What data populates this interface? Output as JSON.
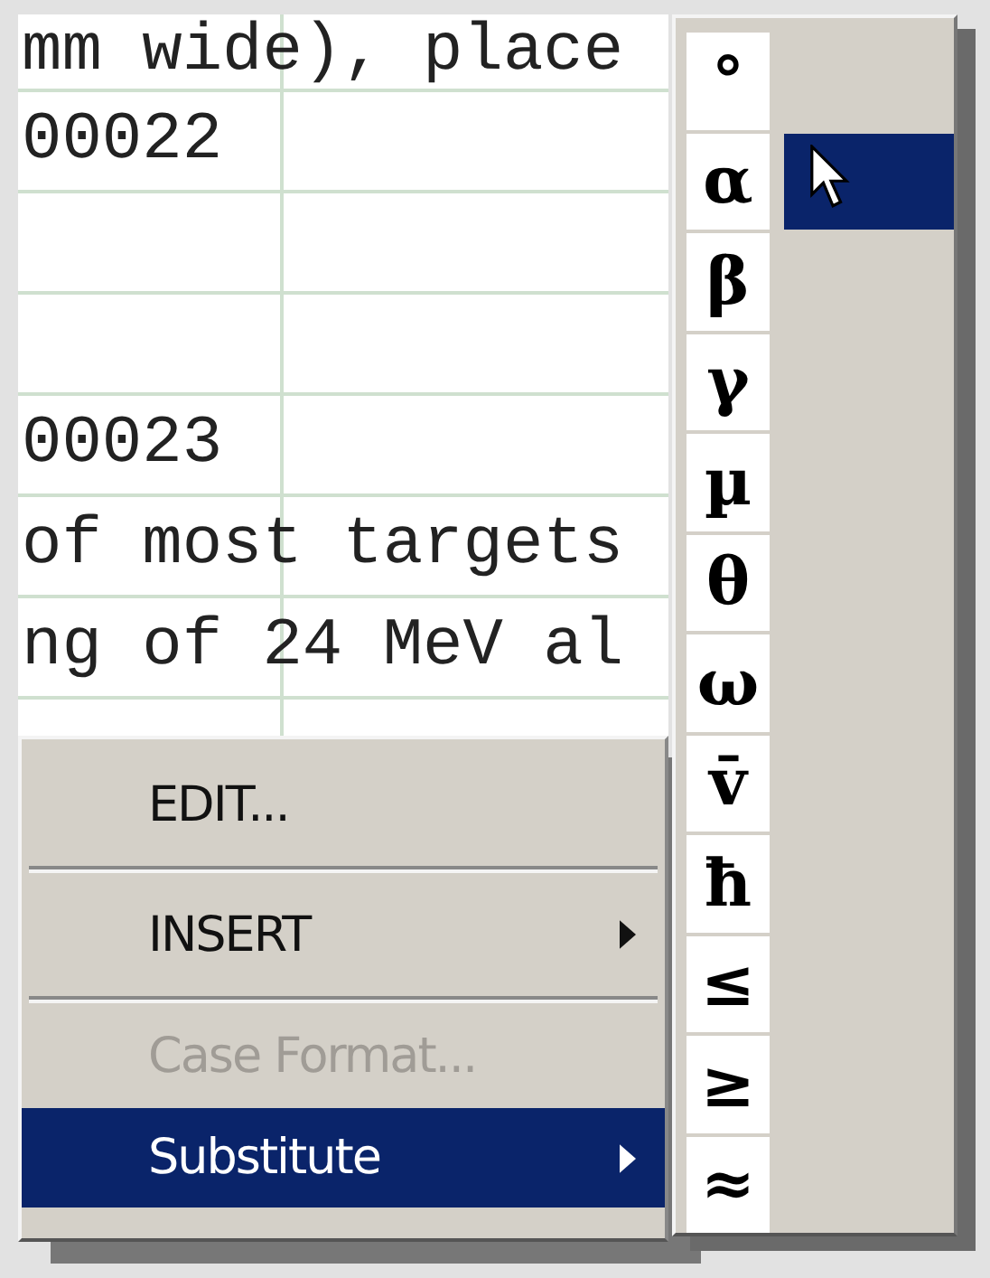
{
  "table": {
    "rows": [
      {
        "text": "mm wide), place"
      },
      {
        "text": "00022"
      },
      {
        "text": ""
      },
      {
        "text": ""
      },
      {
        "text": "00023"
      },
      {
        "text": "of most targets"
      },
      {
        "text": "ng of 24 MeV al"
      }
    ]
  },
  "context_menu": {
    "items": [
      {
        "kind": "item",
        "label": "EDIT...",
        "submenu": false,
        "disabled": false,
        "selected": false
      },
      {
        "kind": "separator"
      },
      {
        "kind": "item",
        "label": "INSERT",
        "submenu": true,
        "disabled": false,
        "selected": false
      },
      {
        "kind": "separator"
      },
      {
        "kind": "item",
        "label": "Case Format...",
        "submenu": false,
        "disabled": true,
        "selected": false
      },
      {
        "kind": "item",
        "label": "Substitute",
        "submenu": true,
        "disabled": false,
        "selected": true
      }
    ]
  },
  "symbol_menu": {
    "items": [
      {
        "symbol": "°",
        "selected": false
      },
      {
        "symbol": "α",
        "selected": true
      },
      {
        "symbol": "β",
        "selected": false
      },
      {
        "symbol": "γ",
        "selected": false
      },
      {
        "symbol": "µ",
        "selected": false
      },
      {
        "symbol": "θ",
        "selected": false
      },
      {
        "symbol": "ω",
        "selected": false
      },
      {
        "symbol": "v̄",
        "selected": false
      },
      {
        "symbol": "ħ",
        "selected": false
      },
      {
        "symbol": "≤",
        "selected": false
      },
      {
        "symbol": "≥",
        "selected": false
      },
      {
        "symbol": "≈",
        "selected": false
      }
    ]
  }
}
